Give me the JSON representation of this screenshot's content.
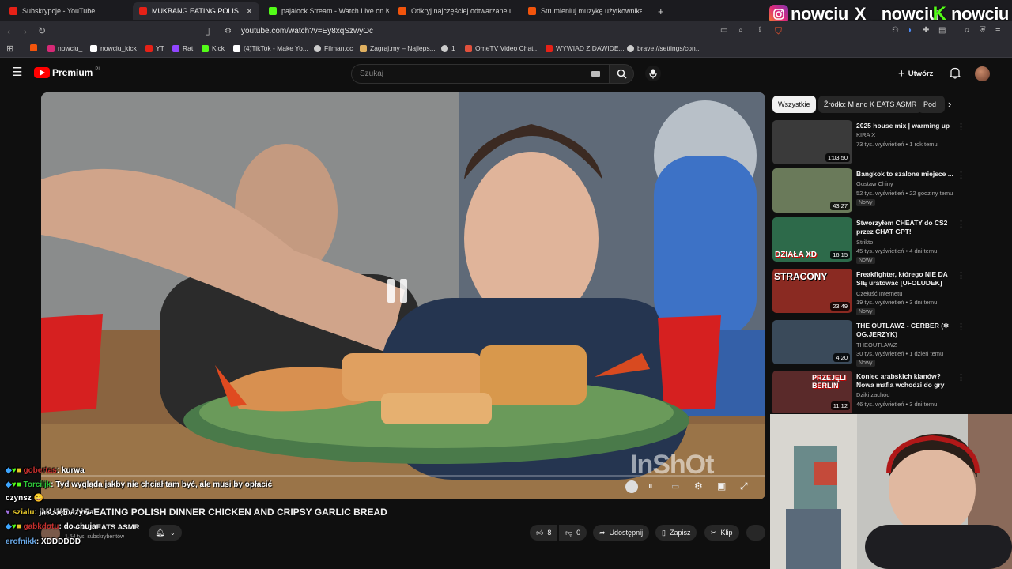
{
  "browser": {
    "tabs": [
      {
        "title": "Subskrypcje - YouTube",
        "color": "#e62117"
      },
      {
        "title": "MUKBANG EATING POLISH D",
        "color": "#e62117",
        "active": true
      },
      {
        "title": "pajalock Stream - Watch Live on Kick",
        "color": "#53fc18"
      },
      {
        "title": "Odkryj najczęściej odtwarzane utwor",
        "color": "#f2540c"
      },
      {
        "title": "Strumieniuj muzykę użytkownika SFW",
        "color": "#f2540c"
      }
    ],
    "new_tab": "+",
    "url": "youtube.com/watch?v=Ey8xqSzwyOc",
    "bookmarks": [
      {
        "label": "nowciu_",
        "color": "#d62976"
      },
      {
        "label": "nowciu_kick",
        "color": "#ffffff"
      },
      {
        "label": "YT",
        "color": "#e62117"
      },
      {
        "label": "Rat",
        "color": "#9146ff"
      },
      {
        "label": "Kick",
        "color": "#53fc18"
      },
      {
        "label": "(4)TikTok - Make Yo...",
        "color": "#ffffff"
      },
      {
        "label": "Filman.cc",
        "color": "#cccccc"
      },
      {
        "label": "Zagraj.my – Najleps...",
        "color": "#e0b060"
      },
      {
        "label": "1",
        "color": "#cccccc"
      },
      {
        "label": "OmeTV Video Chat...",
        "color": "#e0503c"
      },
      {
        "label": "WYWIAD Z DAWIDE...",
        "color": "#e62117"
      },
      {
        "label": "brave://settings/con...",
        "color": "#cccccc"
      }
    ]
  },
  "socials": [
    {
      "icon": "instagram-icon",
      "handle": "nowciu_"
    },
    {
      "icon": "x-icon",
      "glyph": "X",
      "handle": "_nowciu"
    },
    {
      "icon": "kick-icon",
      "glyph": "K",
      "handle": "nowciu"
    }
  ],
  "youtube": {
    "logo": "Premium",
    "logo_suffix": "PL",
    "search_placeholder": "Szukaj",
    "create_label": "Utwórz",
    "filter_chips": [
      "Wszystkie",
      "Źródło: M and K EATS ASMR",
      "Pod"
    ],
    "video": {
      "title": "MUKBANG EATING POLISH DINNER CHICKEN AND CRIPSY GARLIC BREAD",
      "channel": "M and K EATS ASMR",
      "subscribers": "1,54 tys. subskrybentów",
      "watermark": "InShOt",
      "likes": "8",
      "dislikes": "0",
      "share_label": "Udostępnij",
      "save_label": "Zapisz",
      "clip_label": "Klip"
    },
    "recommendations": [
      {
        "title": "2025 house mix | warming up",
        "channel": "KIRA X",
        "meta": "73 tys. wyświetleń • 1 rok temu",
        "duration": "1:03:50",
        "badge": "",
        "thumb": "#3a3a3a"
      },
      {
        "title": "Bangkok to szalone miejsce ...",
        "channel": "Gustaw Chiny",
        "meta": "52 tys. wyświetleń • 22 godziny temu",
        "duration": "43:27",
        "badge": "Nowy",
        "thumb": "#6a7a5a"
      },
      {
        "title": "Stworzyłem CHEATY do CS2 przez CHAT GPT!",
        "channel": "Strikto",
        "meta": "45 tys. wyświetleń • 4 dni temu",
        "duration": "16:15",
        "badge": "Nowy",
        "thumb": "#2d6a4a",
        "thumb_text": "DZIAŁA XD"
      },
      {
        "title": "Freakfighter, którego NIE DA SIĘ uratować [UFOLUDEK]",
        "channel": "Czełuść Internetu",
        "meta": "19 tys. wyświetleń • 3 dni temu",
        "duration": "23:49",
        "badge": "Nowy",
        "thumb": "#8a2a22",
        "thumb_text": "STRACONY"
      },
      {
        "title": "THE OUTLAWZ - CERBER (❄ OG.JERZYK)",
        "channel": "THEOUTLAWZ",
        "meta": "30 tys. wyświetleń • 1 dzień temu",
        "duration": "4:20",
        "badge": "Nowy",
        "thumb": "#3a4a5a"
      },
      {
        "title": "Koniec arabskich klanów? Nowa mafia wchodzi do gry",
        "channel": "Dziki zachód",
        "meta": "46 tys. wyświetleń • 3 dni temu",
        "duration": "11:12",
        "badge": "Nowy",
        "thumb": "#5a2a2a",
        "thumb_text": "PRZEJĘLI BERLIN"
      }
    ]
  },
  "chat": [
    {
      "user": "gobertas",
      "text": "kurwa",
      "color": "#c7302e"
    },
    {
      "user": "Torciljk",
      "text": "Tyd wygląda jakby nie chciał tam być, ale musi by opłacić",
      "color": "#2ec93a"
    },
    {
      "user": "",
      "text": "czynsz 😀",
      "color": "#ffffff"
    },
    {
      "user": "szialu",
      "text": "jak się nazywa",
      "color": "#e6c72a"
    },
    {
      "user": "gabkdotu",
      "text": "do chuja",
      "color": "#c7302e"
    },
    {
      "user": "erofnikk",
      "text": "XDDDDDD",
      "color": "#6aa8e6"
    }
  ],
  "colors": {
    "accent": "#ff0000",
    "kick": "#53fc18"
  }
}
